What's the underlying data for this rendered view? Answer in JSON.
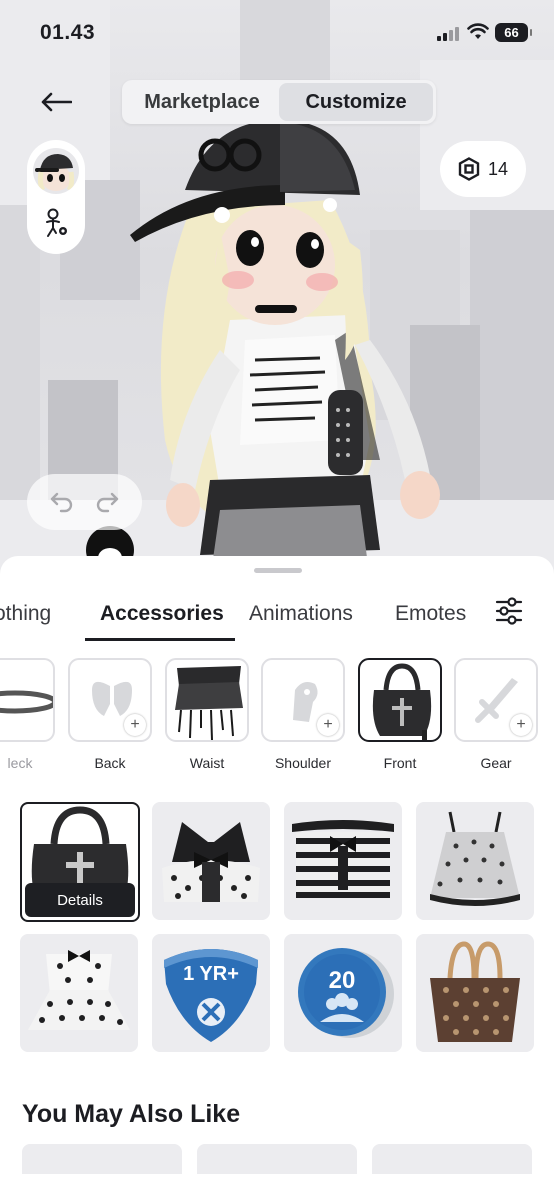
{
  "status_bar": {
    "time": "01.43",
    "battery": "66"
  },
  "header": {
    "tabs": [
      {
        "label": "Marketplace",
        "active": false
      },
      {
        "label": "Customize",
        "active": true
      }
    ],
    "robux_balance": "14"
  },
  "categories": [
    {
      "label": "Clothing",
      "visible_label": "othing",
      "active": false
    },
    {
      "label": "Accessories",
      "active": true
    },
    {
      "label": "Animations",
      "active": false
    },
    {
      "label": "Emotes",
      "active": false
    }
  ],
  "subcategories": [
    {
      "label": "Neck",
      "visible_label": "leck",
      "selected": false,
      "icon": "necklace-icon"
    },
    {
      "label": "Back",
      "selected": false,
      "icon": "wings-icon"
    },
    {
      "label": "Waist",
      "selected": false,
      "icon": "waist-skirt-thumbnail"
    },
    {
      "label": "Shoulder",
      "selected": false,
      "icon": "shoulder-pet-icon"
    },
    {
      "label": "Front",
      "selected": true,
      "icon": "front-bag-thumbnail"
    },
    {
      "label": "Gear",
      "selected": false,
      "icon": "sword-icon"
    }
  ],
  "items": [
    {
      "name": "black cross bag",
      "selected": true,
      "action_label": "Details"
    },
    {
      "name": "black polka dot bow top"
    },
    {
      "name": "striped off-shoulder bow top"
    },
    {
      "name": "grey polka dot cami dress"
    },
    {
      "name": "white polka dot bow top"
    },
    {
      "name": "1 YR+ badge",
      "badge_text": "1 YR+"
    },
    {
      "name": "20 friends coin",
      "badge_text": "20"
    },
    {
      "name": "monogram tote bag"
    }
  ],
  "recommendations": {
    "title": "You May Also Like"
  },
  "colors": {
    "accent": "#1c1d22",
    "badge_blue": "#2c6fb7",
    "tile_bg": "#ececef"
  }
}
